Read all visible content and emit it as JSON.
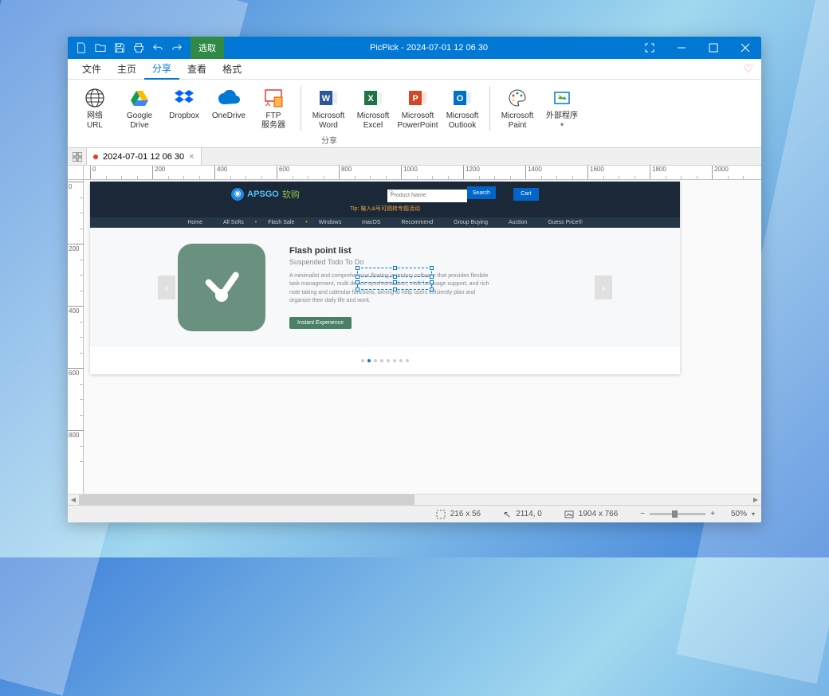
{
  "window": {
    "mode": "选取",
    "title": "PicPick - 2024-07-01 12 06 30"
  },
  "menu": {
    "file": "文件",
    "home": "主页",
    "share": "分享",
    "view": "查看",
    "format": "格式"
  },
  "ribbon": {
    "web_url": "网络\nURL",
    "google_drive": "Google\nDrive",
    "dropbox": "Dropbox",
    "onedrive": "OneDrive",
    "ftp": "FTP\n服务器",
    "word": "Microsoft\nWord",
    "excel": "Microsoft\nExcel",
    "powerpoint": "Microsoft\nPowerPoint",
    "outlook": "Microsoft\nOutlook",
    "paint": "Microsoft\nPaint",
    "external": "外部程序",
    "group_label": "分享"
  },
  "tabs": {
    "doc1": "2024-07-01 12 06 30"
  },
  "ruler_h": [
    0,
    200,
    400,
    600,
    800,
    1000,
    1200,
    1400,
    1600,
    1800,
    2000
  ],
  "ruler_v": [
    0,
    200,
    400,
    600,
    800
  ],
  "page": {
    "logo_text": "APSGO",
    "logo_cn": "软购",
    "search_placeholder": "Product Name",
    "search_btn": "Search",
    "cart_btn": "Cart",
    "tip": "Tip:  输入&号可跳转专题活动",
    "nav": [
      "Home",
      "All Softs",
      "Flash Sale",
      "Windows",
      "macOS",
      "Recommend",
      "Group Buying",
      "Auction",
      "Guess Price®"
    ],
    "hero_title": "Flash point list",
    "hero_sub": "Suspended Todo To Do",
    "hero_desc": "A minimalist and comprehensive floating inventory software that provides flexible task management, multi device synchronization, multi language support, and rich note taking and calendar functions, aiming to help users efficiently plan and organize their daily life and work.",
    "hero_cta": "Instant Experience"
  },
  "status": {
    "selection": "216 x 56",
    "cursor": "2114, 0",
    "image_size": "1904 x 766",
    "zoom": "50%"
  }
}
